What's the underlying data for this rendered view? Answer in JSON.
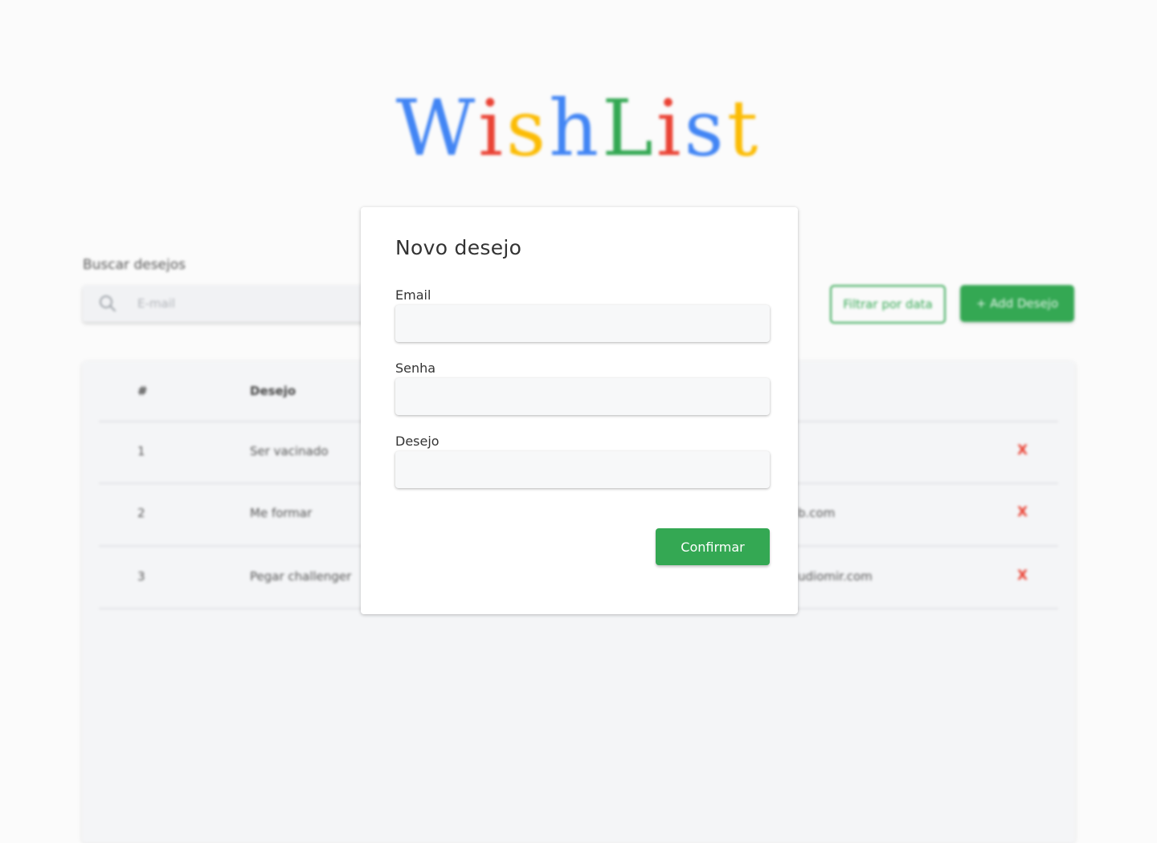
{
  "logo": {
    "letters": [
      {
        "char": "W",
        "color": "#4285f4"
      },
      {
        "char": "i",
        "color": "#ea4335"
      },
      {
        "char": "s",
        "color": "#fbbc05"
      },
      {
        "char": "h",
        "color": "#4285f4"
      },
      {
        "char": "L",
        "color": "#34a853"
      },
      {
        "char": "i",
        "color": "#ea4335"
      },
      {
        "char": "s",
        "color": "#4285f4"
      },
      {
        "char": "t",
        "color": "#fbbc05"
      }
    ]
  },
  "search": {
    "label": "Buscar desejos",
    "placeholder": "E-mail",
    "icon": "search-icon"
  },
  "actions": {
    "filter_label": "Filtrar por data",
    "add_label": "+ Add Desejo"
  },
  "table": {
    "headers": {
      "index": "#",
      "wish": "Desejo"
    },
    "rows": [
      {
        "index": "1",
        "wish": "Ser vacinado",
        "email": "",
        "delete": "X"
      },
      {
        "index": "2",
        "wish": "Me formar",
        "email": "b.com",
        "delete": "X"
      },
      {
        "index": "3",
        "wish": "Pegar challenger",
        "email": "udiomir.com",
        "delete": "X"
      }
    ]
  },
  "modal": {
    "title": "Novo desejo",
    "fields": {
      "email": {
        "label": "Email",
        "value": ""
      },
      "password": {
        "label": "Senha",
        "value": ""
      },
      "wish": {
        "label": "Desejo",
        "value": ""
      }
    },
    "confirm_label": "Confirmar"
  },
  "colors": {
    "primary_green": "#34a853",
    "danger_red": "#ea4335",
    "google_blue": "#4285f4",
    "google_yellow": "#fbbc05"
  }
}
